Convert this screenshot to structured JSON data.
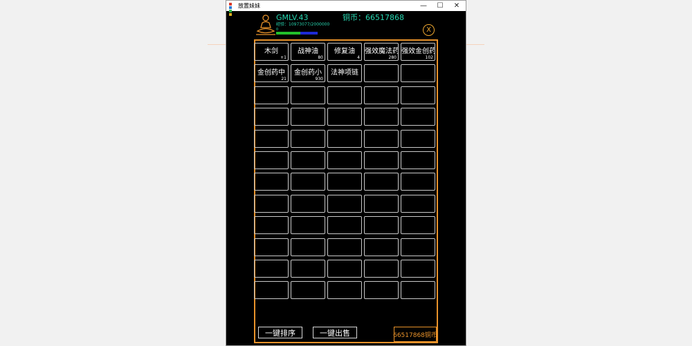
{
  "window": {
    "title": "放置妹妹",
    "minimize_icon": "—",
    "maximize_icon": "☐",
    "close_icon": "✕"
  },
  "header": {
    "level": "GMLV.43",
    "coins": "铜币：66517868",
    "exp": "经验：10973077/2000000",
    "exp_zero": "0",
    "exp_progress": 1.0,
    "close_label": "X"
  },
  "bag": {
    "rows": [
      [
        {
          "name": "木剑",
          "count": "+1"
        },
        {
          "name": "战神油",
          "count": "80"
        },
        {
          "name": "修复油",
          "count": "4"
        },
        {
          "name": "强效魔法药",
          "count": "280"
        },
        {
          "name": "强效金创药",
          "count": "102"
        }
      ],
      [
        {
          "name": "金创药中",
          "count": "21"
        },
        {
          "name": "金创药小",
          "count": "930"
        },
        {
          "name": "法神项链",
          "count": ""
        },
        {
          "name": "",
          "count": ""
        },
        {
          "name": "",
          "count": ""
        }
      ],
      [
        {
          "name": "",
          "count": ""
        },
        {
          "name": "",
          "count": ""
        },
        {
          "name": "",
          "count": ""
        },
        {
          "name": "",
          "count": ""
        },
        {
          "name": "",
          "count": ""
        }
      ],
      [
        {
          "name": "",
          "count": ""
        },
        {
          "name": "",
          "count": ""
        },
        {
          "name": "",
          "count": ""
        },
        {
          "name": "",
          "count": ""
        },
        {
          "name": "",
          "count": ""
        }
      ],
      [
        {
          "name": "",
          "count": ""
        },
        {
          "name": "",
          "count": ""
        },
        {
          "name": "",
          "count": ""
        },
        {
          "name": "",
          "count": ""
        },
        {
          "name": "",
          "count": ""
        }
      ],
      [
        {
          "name": "",
          "count": ""
        },
        {
          "name": "",
          "count": ""
        },
        {
          "name": "",
          "count": ""
        },
        {
          "name": "",
          "count": ""
        },
        {
          "name": "",
          "count": ""
        }
      ],
      [
        {
          "name": "",
          "count": ""
        },
        {
          "name": "",
          "count": ""
        },
        {
          "name": "",
          "count": ""
        },
        {
          "name": "",
          "count": ""
        },
        {
          "name": "",
          "count": ""
        }
      ],
      [
        {
          "name": "",
          "count": ""
        },
        {
          "name": "",
          "count": ""
        },
        {
          "name": "",
          "count": ""
        },
        {
          "name": "",
          "count": ""
        },
        {
          "name": "",
          "count": ""
        }
      ],
      [
        {
          "name": "",
          "count": ""
        },
        {
          "name": "",
          "count": ""
        },
        {
          "name": "",
          "count": ""
        },
        {
          "name": "",
          "count": ""
        },
        {
          "name": "",
          "count": ""
        }
      ],
      [
        {
          "name": "",
          "count": ""
        },
        {
          "name": "",
          "count": ""
        },
        {
          "name": "",
          "count": ""
        },
        {
          "name": "",
          "count": ""
        },
        {
          "name": "",
          "count": ""
        }
      ],
      [
        {
          "name": "",
          "count": ""
        },
        {
          "name": "",
          "count": ""
        },
        {
          "name": "",
          "count": ""
        },
        {
          "name": "",
          "count": ""
        },
        {
          "name": "",
          "count": ""
        }
      ],
      [
        {
          "name": "",
          "count": ""
        },
        {
          "name": "",
          "count": ""
        },
        {
          "name": "",
          "count": ""
        },
        {
          "name": "",
          "count": ""
        },
        {
          "name": "",
          "count": ""
        }
      ]
    ]
  },
  "footer": {
    "sort_label": "一键排序",
    "sell_label": "一键出售",
    "coins_label": "66517868铜币"
  },
  "colors": {
    "accent_orange": "#e8922a",
    "text_teal": "#27d6b0",
    "exp_green": "#22c02b",
    "exp_blue": "#1d2ad6"
  },
  "icons": {
    "app": "app-icon",
    "avatar": "buddha-icon"
  }
}
